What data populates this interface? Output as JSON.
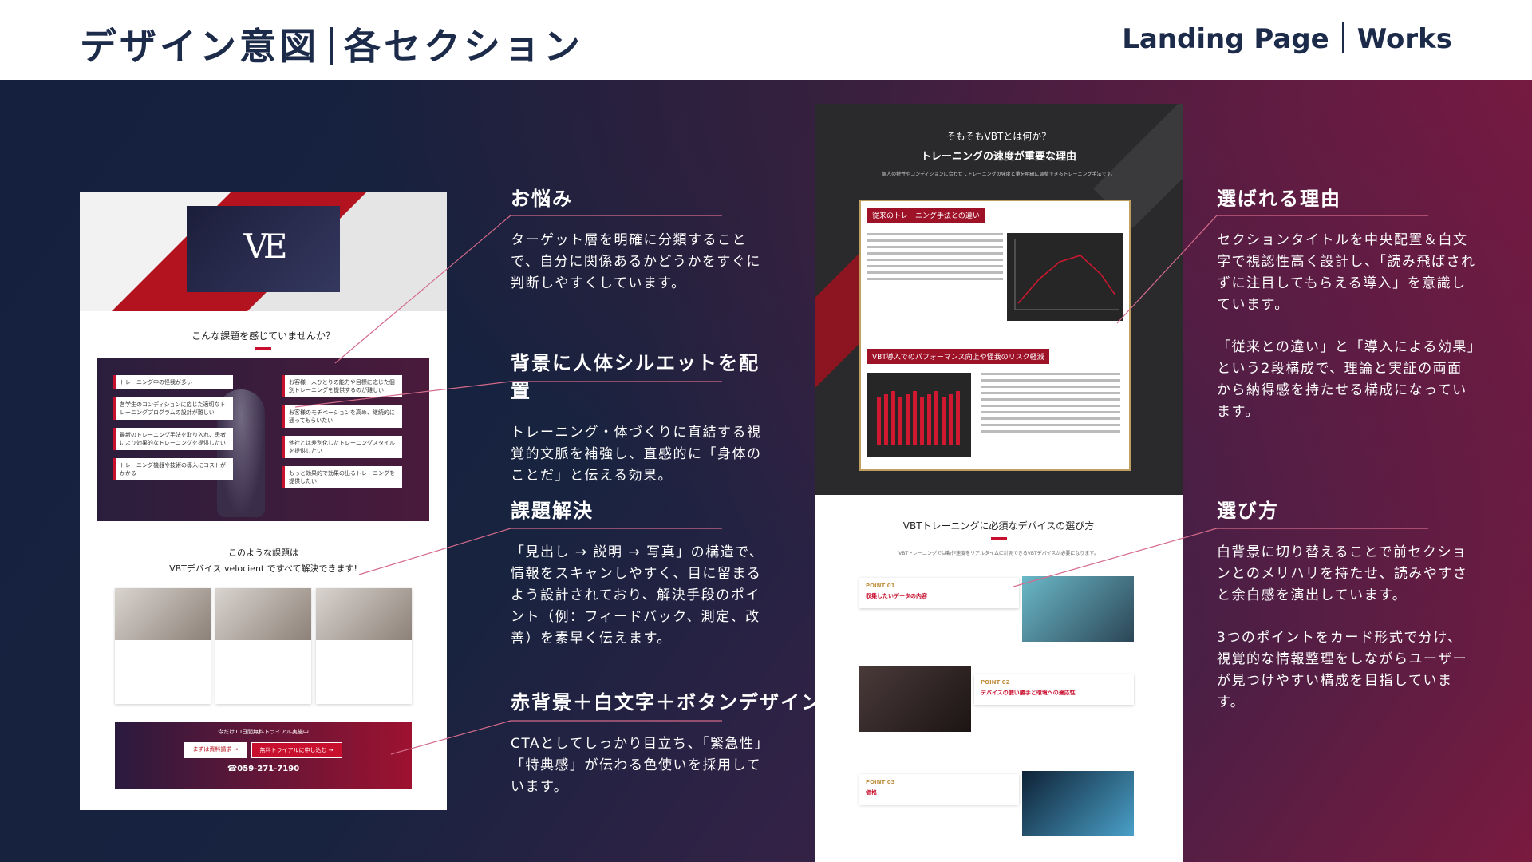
{
  "header": {
    "title_left": "デザイン意図",
    "title_right": "各セクション",
    "sub_left": "Landing Page",
    "sub_right": "Works"
  },
  "mock_left": {
    "hero_logo": "VE",
    "question": "こんな課題を感じていませんか？",
    "solution_line1": "このような課題は",
    "solution_line2": "VBTデバイス velocient ですべて解決できます!",
    "cta_banner": "今だけ10日間無料トライアル実施中",
    "cta_btn1": "まずは資料請求 →",
    "cta_btn2": "無料トライアルに申し込む →",
    "cta_tel": "059-271-7190",
    "problems": [
      "トレーニング中の怪我が多い",
      "各学生のコンディションに応じた適切なトレーニングプログラムの設計が難しい",
      "お客様一人ひとりの能力や目標に応じた個別トレーニングを提供するのが難しい",
      "お客様のモチベーションを高め、継続的に通ってもらいたい",
      "最新のトレーニング手法を取り入れ、患者により効果的なトレーニングを提供したい",
      "他社とは差別化したトレーニングスタイルを提供したい",
      "トレーニング機器や技術の導入にコストがかかる",
      "もっと効果的で効果の出るトレーニングを提供したい"
    ]
  },
  "mock_right": {
    "top_line1": "そもそもVBTとは何か？",
    "top_line2": "トレーニングの速度が重要な理由",
    "top_desc": "個人の特性やコンディションに合わせてトレーニングの強度と量を明確に調整できるトレーニング手法です。",
    "tag1": "従来のトレーニング手法との違い",
    "tag2": "VBT導入でのパフォーマンス向上や怪我のリスク軽減",
    "section_title": "VBTトレーニングに必須なデバイスの選び方",
    "section_sub": "VBTトレーニングでは動作速度をリアルタイムに計測できるVBTデバイスが必要になります。",
    "points": [
      {
        "label": "POINT 01",
        "title": "収集したいデータの内容"
      },
      {
        "label": "POINT 02",
        "title": "デバイスの使い勝手と環境への適応性"
      },
      {
        "label": "POINT 03",
        "title": "価格"
      }
    ]
  },
  "annotations": {
    "onayami": {
      "title": "お悩み",
      "body": "ターゲット層を明確に分類することで、自分に関係あるかどうかをすぐに判断しやすくしています。"
    },
    "haikei": {
      "title": "背景に人体シルエットを配置",
      "body": "トレーニング・体づくりに直結する視覚的文脈を補強し、直感的に「身体のことだ」と伝える効果。"
    },
    "kadai": {
      "title": "課題解決",
      "body": "「見出し → 説明 → 写真」の構造で、情報をスキャンしやすく、目に留まるよう設計されており、解決手段のポイント（例：フィードバック、測定、改善）を素早く伝えます。"
    },
    "cta": {
      "title": "赤背景＋白文字＋ボタンデザイン",
      "body": "CTAとしてしっかり目立ち、「緊急性」「特典感」が伝わる色使いを採用しています。"
    },
    "erabareru": {
      "title": "選ばれる理由",
      "body1": "セクションタイトルを中央配置＆白文字で視認性高く設計し、「読み飛ばされずに注目してもらえる導入」を意識しています。",
      "body2": "「従来との違い」と「導入による効果」という2段構成で、理論と実証の両面から納得感を持たせる構成になっています。"
    },
    "erabikata": {
      "title": "選び方",
      "body1": "白背景に切り替えることで前セクションとのメリハリを持たせ、読みやすさと余白感を演出しています。",
      "body2": "3つのポイントをカード形式で分け、視覚的な情報整理をしながらユーザーが見つけやすい構成を目指しています。"
    }
  },
  "colors": {
    "navy": "#1d2b4a",
    "accent_red": "#c8102e",
    "line_pink": "#d46a8a"
  }
}
